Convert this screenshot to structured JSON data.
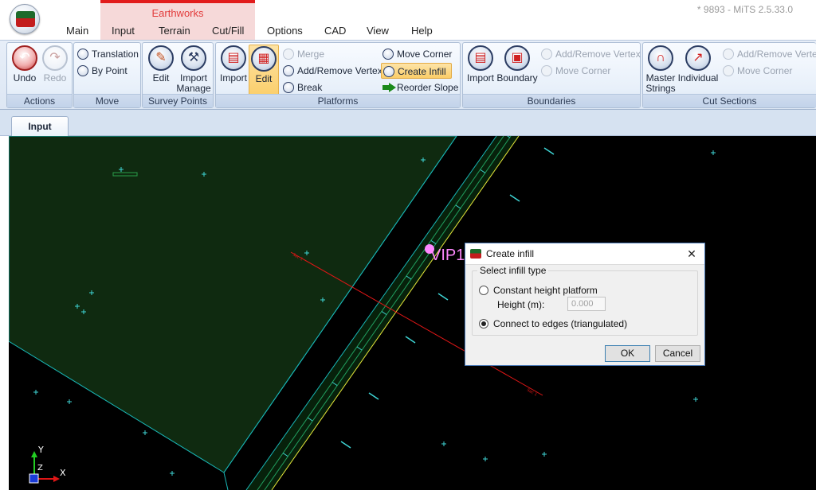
{
  "window": {
    "title": "* 9893 - MiTS 2.5.33.0",
    "logo_text": "MiTS"
  },
  "context_tab_group": {
    "label": "Earthworks",
    "color": "#e21c1c"
  },
  "tabs": [
    "Main",
    "Input",
    "Terrain",
    "Cut/Fill",
    "Options",
    "CAD",
    "View",
    "Help"
  ],
  "ribbon": {
    "actions": {
      "label": "Actions",
      "undo": "Undo",
      "redo": "Redo"
    },
    "move": {
      "label": "Move",
      "translation": "Translation",
      "by_point": "By Point"
    },
    "survey_points": {
      "label": "Survey Points",
      "edit": "Edit",
      "import_manage_1": "Import",
      "import_manage_2": "Manage"
    },
    "platforms": {
      "label": "Platforms",
      "import": "Import",
      "edit": "Edit",
      "merge": "Merge",
      "add_remove_vertex": "Add/Remove Vertex",
      "break": "Break",
      "move_corner": "Move Corner",
      "create_infill": "Create Infill",
      "reorder_slope": "Reorder Slope"
    },
    "boundaries": {
      "label": "Boundaries",
      "import": "Import",
      "boundary": "Boundary",
      "add_remove_vertex": "Add/Remove Vertex",
      "move_corner": "Move Corner"
    },
    "cut_sections": {
      "label": "Cut Sections",
      "master_1": "Master",
      "master_2": "Strings",
      "individual": "Individual",
      "add_remove_vertex": "Add/Remove Vertex",
      "move_corner": "Move Corner"
    }
  },
  "document_tabs": [
    "Input"
  ],
  "canvas": {
    "vip_label": "VIP1",
    "axis_y": "Y",
    "axis_x": "X",
    "axis_z": "Z",
    "colors": {
      "background": "#000000",
      "platform_fill": "#0f2a10",
      "road_line": "#19b6b6",
      "edge_line": "#e8e83a",
      "section_line": "#e01616",
      "point_marker": "#3fd6d6",
      "vip_color": "#ff88ff"
    }
  },
  "dialog": {
    "title": "Create infill",
    "group_title": "Select infill type",
    "option_constant": "Constant height platform",
    "height_label": "Height (m):",
    "height_value": "0.000",
    "option_edges": "Connect to edges (triangulated)",
    "selected_option": "Connect to edges (triangulated)",
    "ok": "OK",
    "cancel": "Cancel"
  }
}
